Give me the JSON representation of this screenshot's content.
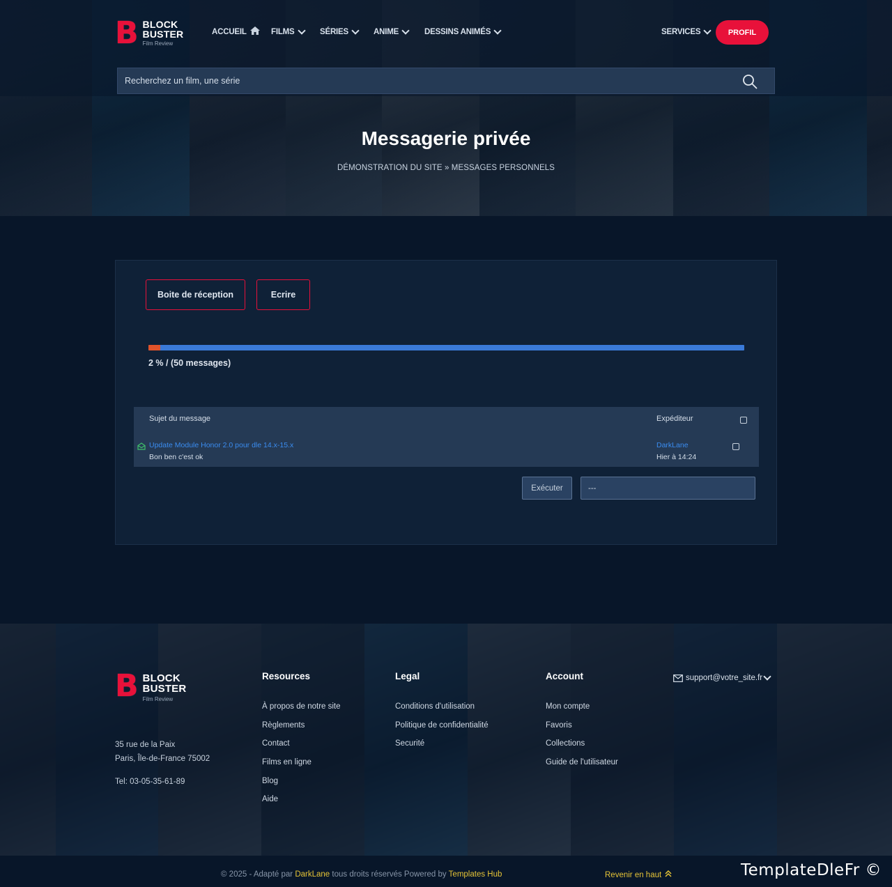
{
  "brand": {
    "line1": "BLOCK",
    "line2": "BUSTER",
    "tagline": "Film Review",
    "letter": "B"
  },
  "nav": {
    "accueil": "ACCUEIL",
    "films": "FILMS",
    "series": "SÉRIES",
    "anime": "ANIME",
    "dessins": "DESSINS ANIMÉS",
    "services": "SERVICES",
    "profil": "PROFIL"
  },
  "search": {
    "placeholder": "Recherchez un film, une série"
  },
  "hero": {
    "title": "Messagerie privée",
    "crumb_home": "DÉMONSTRATION DU SITE",
    "crumb_sep": "»",
    "crumb_current": "MESSAGES PERSONNELS"
  },
  "pm": {
    "inbox_label": "Boite de réception",
    "write_label": "Ecrire",
    "progress_fraction": 0.02,
    "progress_text": "2 % / (50 messages)",
    "col_subject": "Sujet du message",
    "col_sender": "Expéditeur",
    "messages": [
      {
        "subject": "Update Module Honor 2.0 pour dle 14.x-15.x",
        "preview": "Bon ben c'est ok",
        "sender": "DarkLane",
        "date": "Hier à 14:24"
      }
    ],
    "execute_label": "Exécuter",
    "action_selected": "---"
  },
  "footer": {
    "address1": "35 rue de la Paix",
    "address2": "Paris, Île-de-France 75002",
    "phone": "Tel: 03-05-35-61-89",
    "resources": {
      "title": "Resources",
      "links": [
        "À propos de notre site",
        "Règlements",
        "Contact",
        "Films en ligne",
        "Blog",
        "Aide"
      ]
    },
    "legal": {
      "title": "Legal",
      "links": [
        "Conditions d'utilisation",
        "Politique de confidentialité",
        "Securité"
      ]
    },
    "account": {
      "title": "Account",
      "links": [
        "Mon compte",
        "Favoris",
        "Collections",
        "Guide de l'utilisateur"
      ]
    },
    "email": "support@votre_site.fr",
    "copy_prefix": "© 2025 - Adapté par",
    "copy_author": "DarkLane",
    "copy_middle": "tous droits réservés Powered by",
    "copy_hub": "Templates Hub",
    "back_top": "Revenir en haut",
    "watermark": "TemplateDleFr ©"
  },
  "colors": {
    "accent": "#e8113a",
    "link": "#3a8cf0",
    "gold": "#e5c337",
    "bg": "#081629",
    "panel": "#0f2137"
  }
}
